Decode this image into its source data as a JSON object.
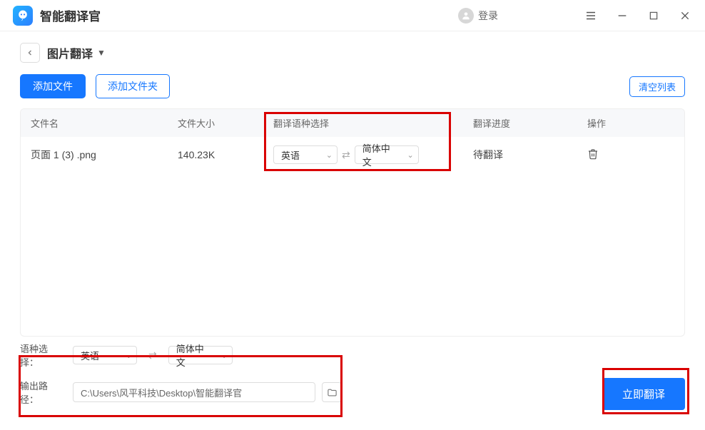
{
  "app": {
    "title": "智能翻译官"
  },
  "header": {
    "login_label": "登录"
  },
  "crumb": {
    "title": "图片翻译"
  },
  "actions": {
    "add_file": "添加文件",
    "add_folder": "添加文件夹",
    "clear_list": "清空列表"
  },
  "table": {
    "headers": {
      "name": "文件名",
      "size": "文件大小",
      "lang": "翻译语种选择",
      "progress": "翻译进度",
      "op": "操作"
    },
    "rows": [
      {
        "name": "页面 1 (3) .png",
        "size": "140.23K",
        "src": "英语",
        "tgt": "简体中文",
        "progress": "待翻译"
      }
    ]
  },
  "footer": {
    "lang_label": "语种选择：",
    "src": "英语",
    "tgt": "简体中文",
    "path_label": "输出路径：",
    "path_value": "C:\\Users\\风平科技\\Desktop\\智能翻译官",
    "translate_btn": "立即翻译"
  }
}
